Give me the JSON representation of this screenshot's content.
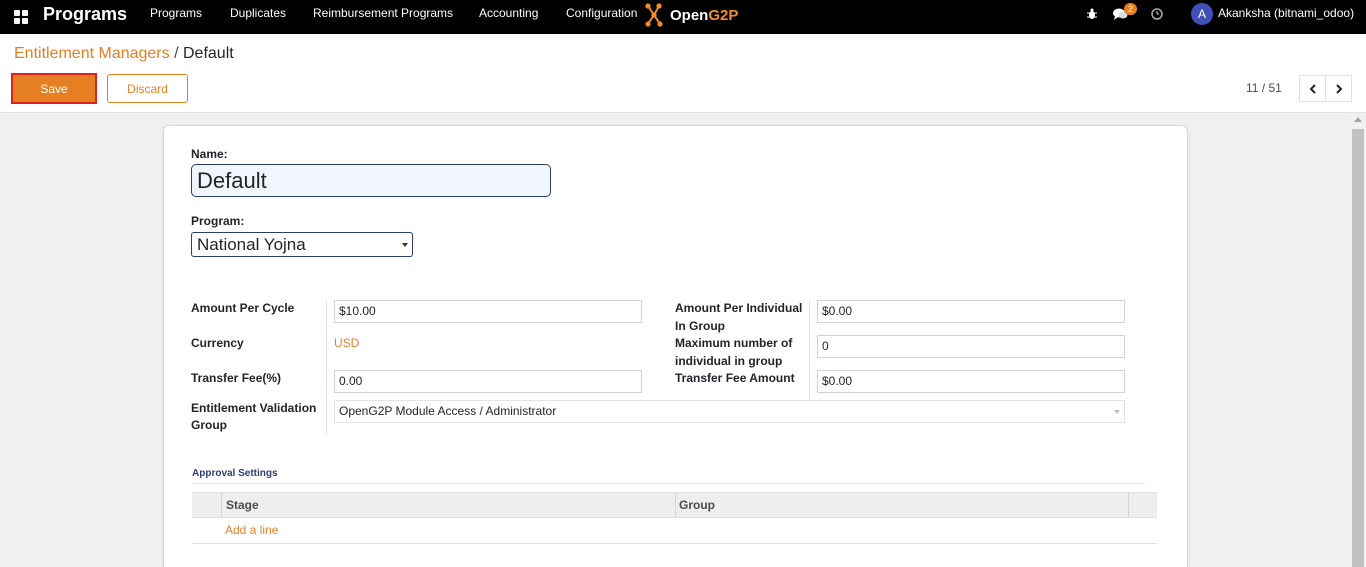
{
  "navbar": {
    "apps_icon": "apps-grid-icon",
    "brand": "Programs",
    "menu": [
      "Programs",
      "Duplicates",
      "Reimbursement Programs",
      "Accounting",
      "Configuration"
    ],
    "logo_text_a": "Open",
    "logo_text_b": "G2P",
    "debug_icon": "bug-icon",
    "messages_icon": "chat-icon",
    "messages_count": "2",
    "activity_icon": "clock-icon",
    "avatar_letter": "A",
    "user_name": "Akanksha (bitnami_odoo)"
  },
  "breadcrumb": {
    "parent": "Entitlement Managers",
    "separator": "/",
    "current": "Default"
  },
  "actions": {
    "save_label": "Save",
    "discard_label": "Discard"
  },
  "pager": {
    "value": "11 / 51",
    "prev_icon": "chevron-left-icon",
    "next_icon": "chevron-right-icon"
  },
  "form": {
    "name_label": "Name:",
    "name_value": "Default",
    "program_label": "Program:",
    "program_value": "National Yojna",
    "amount_per_cycle_label": "Amount Per Cycle",
    "amount_per_cycle_value": "$10.00",
    "currency_label": "Currency",
    "currency_value": "USD",
    "transfer_fee_label": "Transfer Fee(%)",
    "transfer_fee_value": "0.00",
    "validation_group_label_1": "Entitlement Validation",
    "validation_group_label_2": "Group",
    "validation_group_value": "OpenG2P Module Access / Administrator",
    "amount_per_individual_label_1": "Amount Per Individual",
    "amount_per_individual_label_2": "In Group",
    "amount_per_individual_value": "$0.00",
    "max_individuals_label_1": "Maximum number of",
    "max_individuals_label_2": "individual in group",
    "max_individuals_value": "0",
    "transfer_fee_amount_label": "Transfer Fee Amount",
    "transfer_fee_amount_value": "$0.00"
  },
  "approval": {
    "title": "Approval Settings",
    "columns": [
      "Stage",
      "Group"
    ],
    "add_line": "Add a line"
  },
  "colors": {
    "accent": "#e67e22",
    "navbar_bg": "#000000",
    "focus_border": "#2c3e6e",
    "save_border": "#e0201c"
  }
}
